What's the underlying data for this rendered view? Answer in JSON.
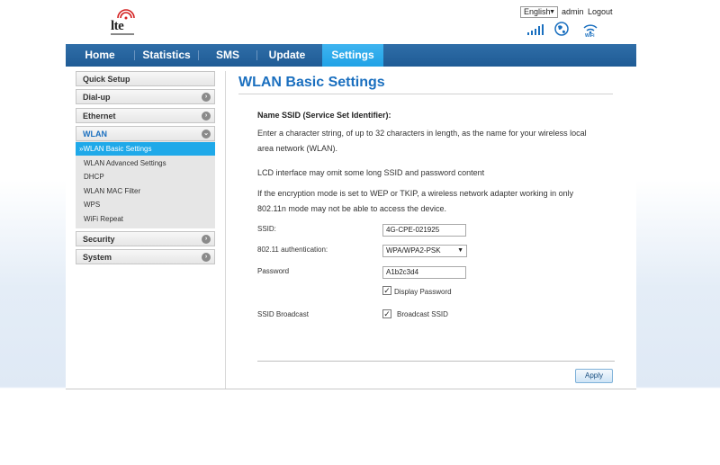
{
  "header": {
    "logo_text": "lte",
    "language": "English",
    "admin_label": "admin",
    "logout_label": "Logout"
  },
  "nav": {
    "tabs": [
      {
        "label": "Home"
      },
      {
        "label": "Statistics"
      },
      {
        "label": "SMS"
      },
      {
        "label": "Update"
      },
      {
        "label": "Settings",
        "active": true
      }
    ]
  },
  "sidebar": {
    "sections": [
      {
        "label": "Quick Setup"
      },
      {
        "label": "Dial-up"
      },
      {
        "label": "Ethernet"
      },
      {
        "label": "WLAN",
        "expanded": true
      },
      {
        "label": "Security"
      },
      {
        "label": "System"
      }
    ],
    "wlan_items": [
      {
        "label": "»WLAN Basic Settings",
        "active": true
      },
      {
        "label": "WLAN Advanced Settings"
      },
      {
        "label": "DHCP"
      },
      {
        "label": "WLAN MAC Filter"
      },
      {
        "label": "WPS"
      },
      {
        "label": "WiFi Repeat"
      }
    ]
  },
  "main": {
    "title": "WLAN Basic Settings",
    "section_heading": "Name SSID (Service Set Identifier):",
    "desc1_line1": "Enter a character string, of up to 32 characters in length, as the name for your wireless local",
    "desc1_line2": "area network (WLAN).",
    "desc2": "LCD interface may omit some long SSID and password content",
    "desc3_line1": "If the encryption mode is set to WEP or TKIP, a wireless network adapter working in only",
    "desc3_line2": "802.11n mode may not be able to access the device.",
    "form": {
      "ssid_label": "SSID:",
      "ssid_value": "4G-CPE-021925",
      "auth_label": "802.11 authentication:",
      "auth_value": "WPA/WPA2-PSK",
      "password_label": "Password",
      "password_value": "A1b2c3d4",
      "display_password_label": "Display Password",
      "display_password_checked": true,
      "broadcast_label": "SSID Broadcast",
      "broadcast_checkbox_label": "Broadcast SSID",
      "broadcast_checked": true
    },
    "apply_label": "Apply"
  },
  "colors": {
    "nav_bg": "#1f5b95",
    "nav_active": "#20a2e6",
    "title_blue": "#1a6fbf",
    "sidebar_active": "#1fa9e9"
  }
}
